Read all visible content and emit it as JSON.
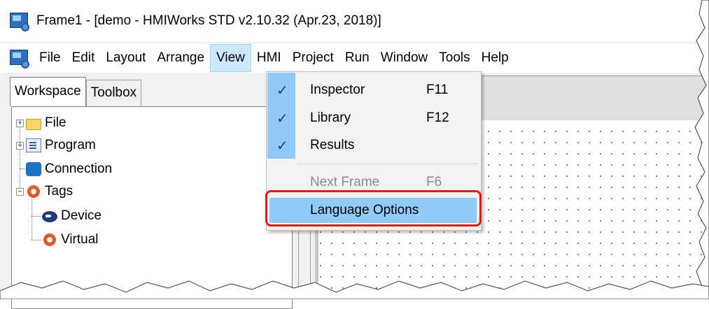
{
  "window": {
    "title": "Frame1 - [demo - HMIWorks STD v2.10.32 (Apr.23, 2018)]"
  },
  "menubar": {
    "items": [
      "File",
      "Edit",
      "Layout",
      "Arrange",
      "View",
      "HMI",
      "Project",
      "Run",
      "Window",
      "Tools",
      "Help"
    ],
    "active": "View"
  },
  "left_panel": {
    "tabs": [
      {
        "label": "Workspace",
        "selected": true
      },
      {
        "label": "Toolbox",
        "selected": false
      }
    ],
    "tree": [
      {
        "label": "File",
        "icon": "folder-icon",
        "expander": "+"
      },
      {
        "label": "Program",
        "icon": "program-icon",
        "expander": "+"
      },
      {
        "label": "Connection",
        "icon": "connection-icon",
        "expander": ""
      },
      {
        "label": "Tags",
        "icon": "tags-icon",
        "expander": "−"
      },
      {
        "label": "Device",
        "icon": "device-icon",
        "expander": ""
      },
      {
        "label": "Virtual",
        "icon": "virtual-tag-icon",
        "expander": ""
      }
    ]
  },
  "view_menu": {
    "items": [
      {
        "label": "Inspector",
        "shortcut": "F11",
        "checked": true,
        "enabled": true
      },
      {
        "label": "Library",
        "shortcut": "F12",
        "checked": true,
        "enabled": true
      },
      {
        "label": "Results",
        "shortcut": "",
        "checked": true,
        "enabled": true
      },
      {
        "label": "Next Frame",
        "shortcut": "F6",
        "checked": false,
        "enabled": false
      },
      {
        "label": "Language Options",
        "shortcut": "",
        "checked": false,
        "enabled": true,
        "highlighted": true
      }
    ],
    "check_glyph": "✓"
  },
  "colors": {
    "highlight_ring": "#e11b1b",
    "menu_highlight": "#91c9f7",
    "menu_active": "#cce8ff"
  }
}
